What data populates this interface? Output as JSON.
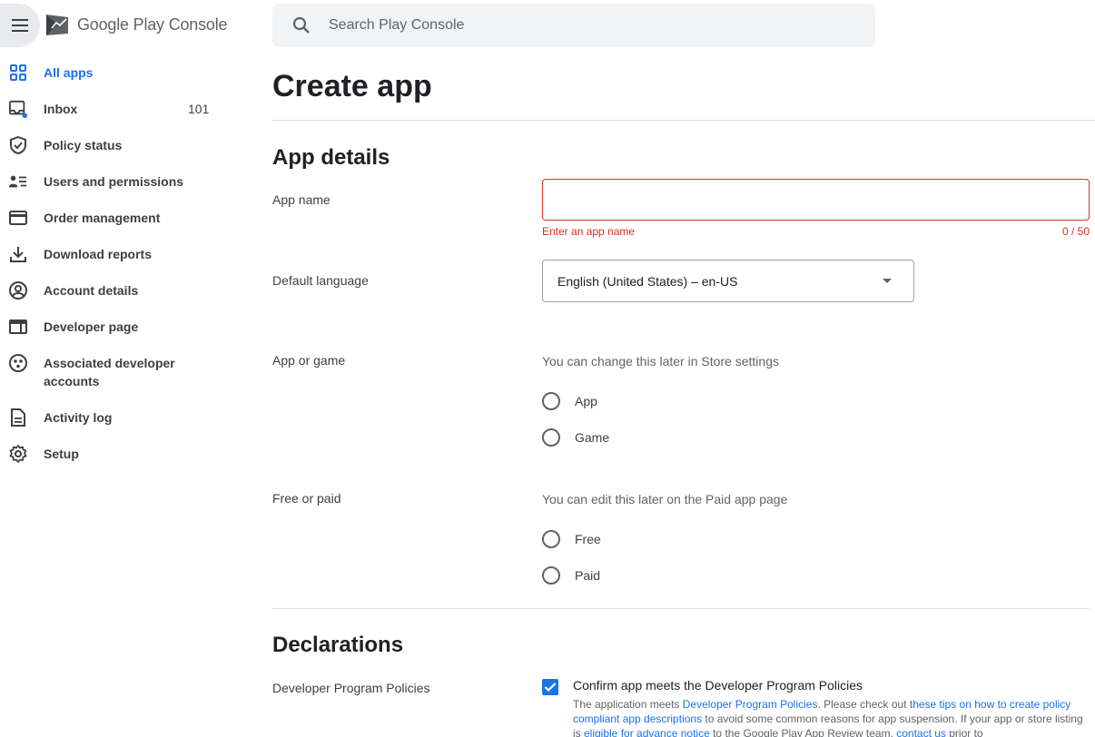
{
  "app": {
    "brand_google": "Google Play",
    "brand_console": "Console"
  },
  "search": {
    "placeholder": "Search Play Console"
  },
  "sidebar": {
    "items": [
      {
        "label": "All apps",
        "icon": "grid-icon",
        "active": true
      },
      {
        "label": "Inbox",
        "icon": "inbox-icon",
        "count": "101"
      },
      {
        "label": "Policy status",
        "icon": "shield-icon"
      },
      {
        "label": "Users and permissions",
        "icon": "people-list-icon"
      },
      {
        "label": "Order management",
        "icon": "credit-card-icon"
      },
      {
        "label": "Download reports",
        "icon": "download-icon"
      },
      {
        "label": "Account details",
        "icon": "account-circle-icon"
      },
      {
        "label": "Developer page",
        "icon": "web-page-icon"
      },
      {
        "label": "Associated developer accounts",
        "icon": "linked-accounts-icon"
      },
      {
        "label": "Activity log",
        "icon": "document-icon"
      },
      {
        "label": "Setup",
        "icon": "gear-icon"
      }
    ]
  },
  "main": {
    "title": "Create app",
    "app_details": {
      "heading": "App details",
      "app_name": {
        "label": "App name",
        "value": "",
        "error": "Enter an app name",
        "counter": "0 / 50"
      },
      "default_language": {
        "label": "Default language",
        "value": "English (United States) – en-US"
      },
      "app_or_game": {
        "label": "App or game",
        "hint": "You can change this later in Store settings",
        "options": [
          "App",
          "Game"
        ]
      },
      "free_or_paid": {
        "label": "Free or paid",
        "hint": "You can edit this later on the Paid app page",
        "options": [
          "Free",
          "Paid"
        ]
      }
    },
    "declarations": {
      "heading": "Declarations",
      "policies": {
        "label": "Developer Program Policies",
        "checkbox_label": "Confirm app meets the Developer Program Policies",
        "checked": true,
        "desc_1": "The application meets ",
        "link_1": "Developer Program Policies",
        "desc_2": ". Please check out ",
        "link_2": "these tips on how to create policy compliant app descriptions",
        "desc_3": " to avoid some common reasons for app suspension. If your app or store listing is ",
        "link_3": "eligible for advance notice",
        "desc_4": " to the Google Play App Review team, ",
        "link_4": "contact us",
        "desc_5": " prior to"
      }
    }
  },
  "colors": {
    "accent": "#1a73e8",
    "error": "#d93025",
    "text": "#202124",
    "muted": "#5f6368"
  }
}
